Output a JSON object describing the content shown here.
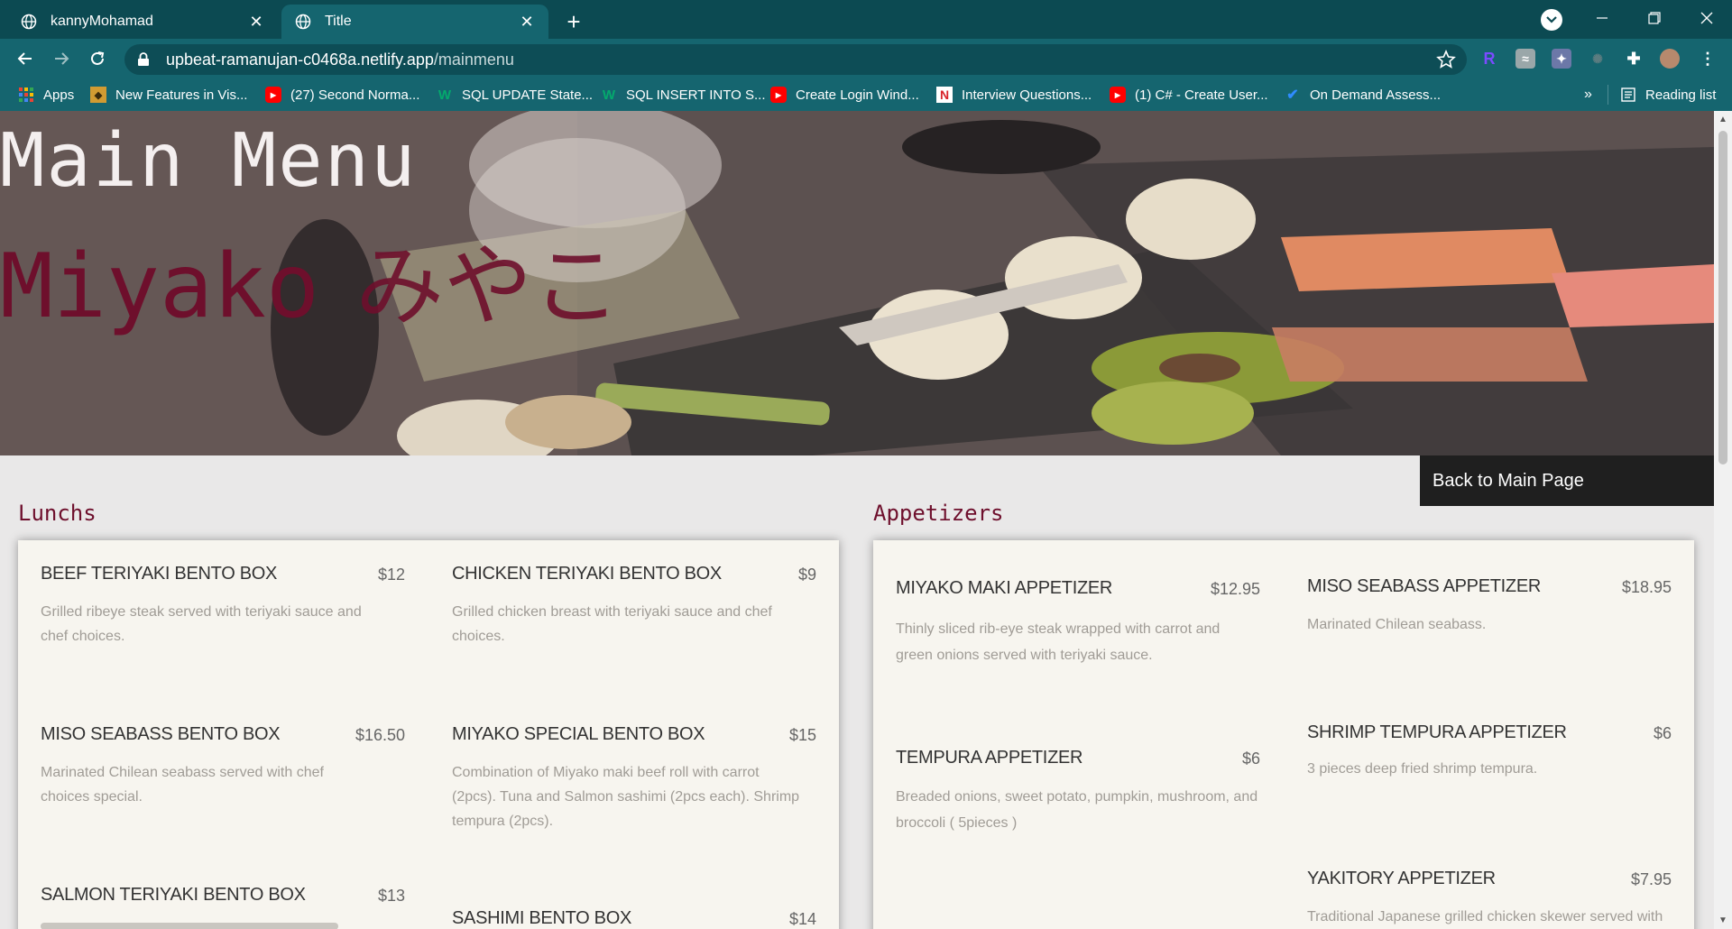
{
  "browser": {
    "tabs": [
      {
        "title": "kannyMohamad",
        "active": false
      },
      {
        "title": "Title",
        "active": true
      }
    ],
    "url_host": "upbeat-ramanujan-c0468a.netlify.app",
    "url_path": "/mainmenu",
    "bookmarks": [
      {
        "label": "Apps",
        "icon": "apps-grid-icon"
      },
      {
        "label": "New Features in Vis...",
        "icon": "bookmark-favicon"
      },
      {
        "label": "(27) Second Norma...",
        "icon": "youtube-icon"
      },
      {
        "label": "SQL UPDATE State...",
        "icon": "w3schools-icon"
      },
      {
        "label": "SQL INSERT INTO S...",
        "icon": "w3schools-icon"
      },
      {
        "label": "Create Login Wind...",
        "icon": "youtube-icon"
      },
      {
        "label": "Interview Questions...",
        "icon": "n-favicon-icon"
      },
      {
        "label": "(1) C# - Create User...",
        "icon": "youtube-icon"
      },
      {
        "label": "On Demand Assess...",
        "icon": "checkmark-icon"
      }
    ],
    "overflow_label": "»",
    "reading_list_label": "Reading list"
  },
  "page": {
    "hero_title": "Main Menu",
    "brand_latin": "Miyako",
    "brand_japanese": "みやこ",
    "back_button": "Back to Main Page",
    "lunch_title": "Lunchs",
    "appetizer_title": "Appetizers"
  },
  "lunches": [
    {
      "name": "BEEF TERIYAKI BENTO BOX",
      "price": "$12",
      "desc": "Grilled ribeye steak served with teriyaki sauce and chef choices."
    },
    {
      "name": "CHICKEN TERIYAKI BENTO BOX",
      "price": "$9",
      "desc": "Grilled chicken breast with teriyaki sauce and chef choices."
    },
    {
      "name": "MISO SEABASS BENTO BOX",
      "price": "$16.50",
      "desc": "Marinated Chilean seabass served with chef choices special."
    },
    {
      "name": "MIYAKO SPECIAL BENTO BOX",
      "price": "$15",
      "desc": "Combination of Miyako maki beef roll with carrot (2pcs). Tuna and Salmon sashimi (2pcs each). Shrimp tempura (2pcs)."
    },
    {
      "name": "SALMON TERIYAKI BENTO BOX",
      "price": "$13",
      "desc": ""
    },
    {
      "name": "SASHIMI BENTO BOX",
      "price": "$14",
      "desc": ""
    }
  ],
  "appetizers": [
    {
      "name": "MIYAKO MAKI APPETIZER",
      "price": "$12.95",
      "desc": "Thinly sliced rib-eye steak wrapped with carrot and green onions served with teriyaki sauce."
    },
    {
      "name": "MISO SEABASS APPETIZER",
      "price": "$18.95",
      "desc": "Marinated Chilean seabass."
    },
    {
      "name": "TEMPURA APPETIZER",
      "price": "$6",
      "desc": "Breaded onions, sweet potato, pumpkin, mushroom, and broccoli ( 5pieces )"
    },
    {
      "name": "SHRIMP TEMPURA APPETIZER",
      "price": "$6",
      "desc": "3 pieces deep fried shrimp tempura."
    },
    {
      "name": "YAKITORY APPETIZER",
      "price": "$7.95",
      "desc": "Traditional Japanese grilled chicken skewer served with"
    }
  ]
}
